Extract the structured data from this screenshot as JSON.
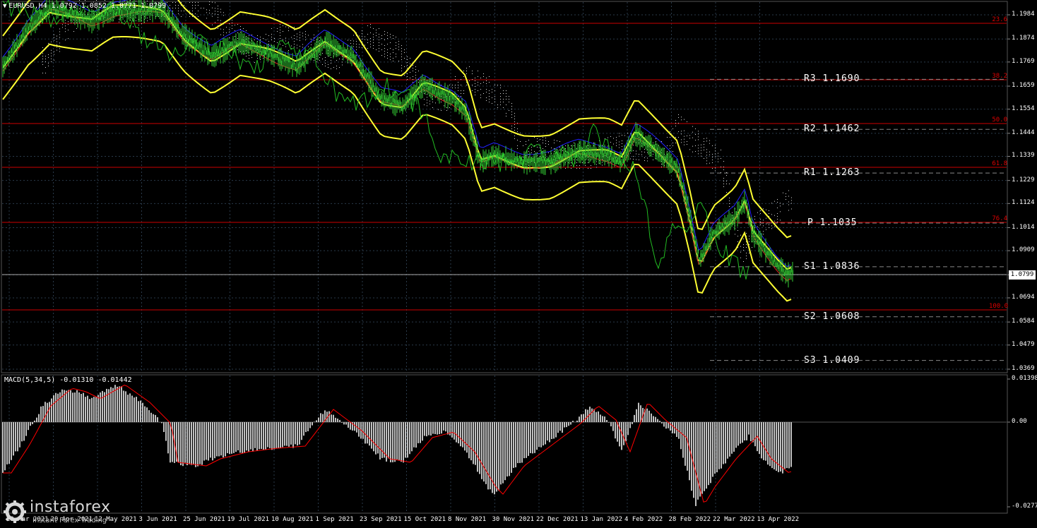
{
  "header": {
    "symbol_line": "EURUSD,H4  1.0792 1.0852 1.0771 1.0799",
    "macd_line": "MACD(5,34,5) -0.01310 -0.01442"
  },
  "price_axis": [
    "1.1984",
    "1.1874",
    "1.1769",
    "1.1659",
    "1.1554",
    "1.1444",
    "1.1339",
    "1.1229",
    "1.1124",
    "1.1014",
    "1.0909",
    "1.0799",
    "1.0694",
    "1.0584",
    "1.0479",
    "1.0369"
  ],
  "macd_axis": [
    "0.01398",
    "0.00",
    "-0.02771"
  ],
  "current_price": "1.0799",
  "pivots": [
    {
      "label": "R3",
      "value": "1.1690"
    },
    {
      "label": "R2",
      "value": "1.1462"
    },
    {
      "label": "R1",
      "value": "1.1263"
    },
    {
      "label": "P",
      "value": "1.1035"
    },
    {
      "label": "S1",
      "value": "1.0836"
    },
    {
      "label": "S2",
      "value": "1.0608"
    },
    {
      "label": "S3",
      "value": "1.0409"
    }
  ],
  "fib_levels": [
    "23.6",
    "38.2",
    "50.0",
    "61.8",
    "76.4",
    "100.0"
  ],
  "time_axis": [
    "29 Mar 2021",
    "20 Apr 2021",
    "12 May 2021",
    "3 Jun 2021",
    "25 Jun 2021",
    "19 Jul 2021",
    "10 Aug 2021",
    "1 Sep 2021",
    "23 Sep 2021",
    "15 Oct 2021",
    "8 Nov 2021",
    "30 Nov 2021",
    "22 Dec 2021",
    "13 Jan 2022",
    "4 Feb 2022",
    "28 Feb 2022",
    "22 Mar 2022",
    "13 Apr 2022"
  ],
  "logo": {
    "brand": "instaforex",
    "tagline": "Instant Forex Trading"
  },
  "colors": {
    "background": "#000000",
    "grid": "#2a3a4a",
    "fib": "#cc0000",
    "bollinger": "#ffff33",
    "candles": "#33cc33",
    "chikou": "#22bb22",
    "kijun": "#2222ff",
    "tenkan": "#dd2222",
    "cloud": "#dddddd",
    "macd_hist": "#c0c0c0",
    "macd_signal": "#ff0000"
  }
}
